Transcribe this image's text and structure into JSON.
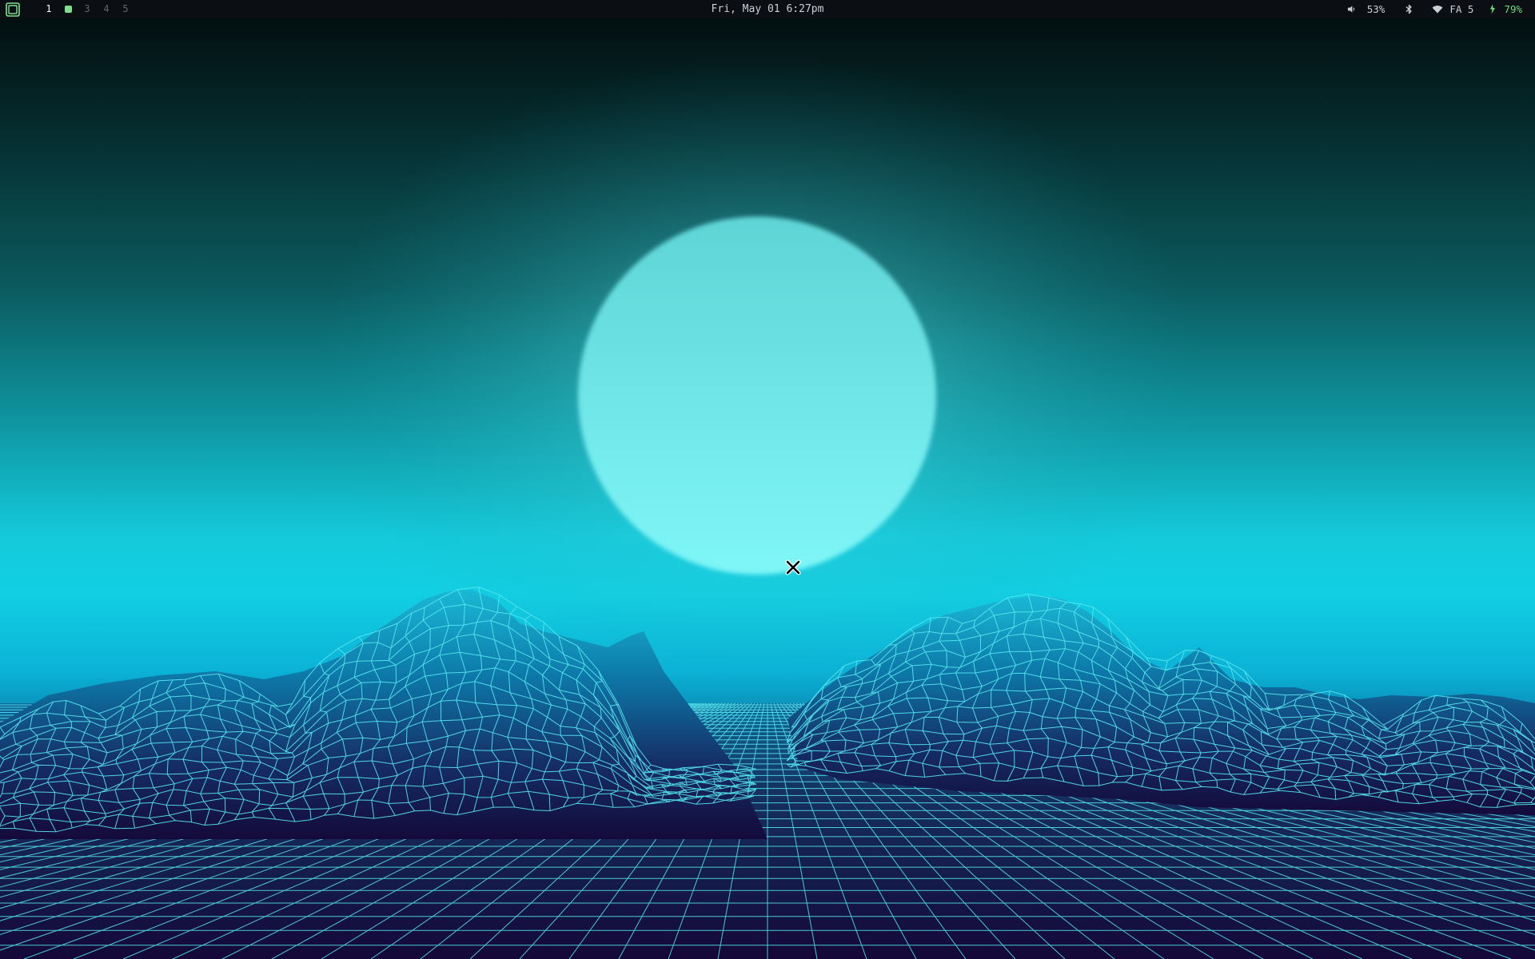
{
  "topbar": {
    "workspaces": [
      {
        "label": "1",
        "state": "active"
      },
      {
        "label": "",
        "state": "occupied-dot"
      },
      {
        "label": "3",
        "state": "inactive"
      },
      {
        "label": "4",
        "state": "inactive"
      },
      {
        "label": "5",
        "state": "inactive"
      }
    ],
    "clock": "Fri, May 01 6:27pm",
    "volume": {
      "icon": "speaker-icon",
      "value": "53%"
    },
    "bluetooth": {
      "icon": "bluetooth-icon"
    },
    "wifi": {
      "icon": "wifi-icon",
      "value": "FA 5"
    },
    "battery": {
      "icon": "battery-charging-icon",
      "value": "79%"
    }
  },
  "cursor": {
    "icon": "x-cursor-icon"
  },
  "colors": {
    "bar_bg": "#0b0e13",
    "bar_text": "#c9cfd6",
    "accent_green": "#6fdc7e",
    "wire": "#56e8f0",
    "sky_top": "#020a0b",
    "sky_horizon": "#0fd2e4",
    "ground": "#120a3a"
  }
}
